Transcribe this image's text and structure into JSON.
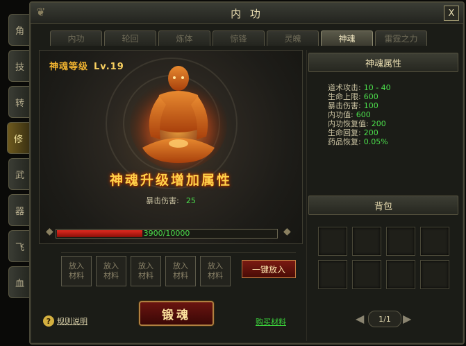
{
  "side_tabs": [
    "角",
    "技",
    "转",
    "修",
    "武",
    "器",
    "飞",
    "血"
  ],
  "window": {
    "title": "内 功",
    "close_label": "X"
  },
  "tabs": [
    {
      "label": "内功",
      "active": false
    },
    {
      "label": "轮回",
      "active": false
    },
    {
      "label": "炼体",
      "active": false
    },
    {
      "label": "惊锋",
      "active": false
    },
    {
      "label": "灵魄",
      "active": false
    },
    {
      "label": "神魂",
      "active": true
    },
    {
      "label": "雷霆之力",
      "active": false
    }
  ],
  "soul": {
    "level_label": "神魂等级",
    "level_value": "Lv.19",
    "banner": "神魂升级增加属性",
    "stat_key": "暴击伤害:",
    "stat_value": "25",
    "progress_text": "3900/10000",
    "progress_fraction": 0.39
  },
  "materials": {
    "slot_line1": "放入",
    "slot_line2": "材料",
    "put_all_label": "一键放入"
  },
  "forge_label": "锻魂",
  "help_label": "规则说明",
  "buy_label": "购买材料",
  "right": {
    "attr_header": "神魂属性",
    "attrs": [
      {
        "k": "道术攻击:",
        "v": "10 - 40"
      },
      {
        "k": "生命上限:",
        "v": "600"
      },
      {
        "k": "暴击伤害:",
        "v": "100"
      },
      {
        "k": "内功值:",
        "v": "600"
      },
      {
        "k": "内功恢复值:",
        "v": "200"
      },
      {
        "k": "生命回复:",
        "v": "200"
      },
      {
        "k": "药品恢复:",
        "v": "0.05%"
      }
    ],
    "bag_header": "背包",
    "page": "1/1"
  },
  "colors": {
    "accent_gold": "#f2b430",
    "value_green": "#4ce04c",
    "progress_red": "#e02a20"
  }
}
